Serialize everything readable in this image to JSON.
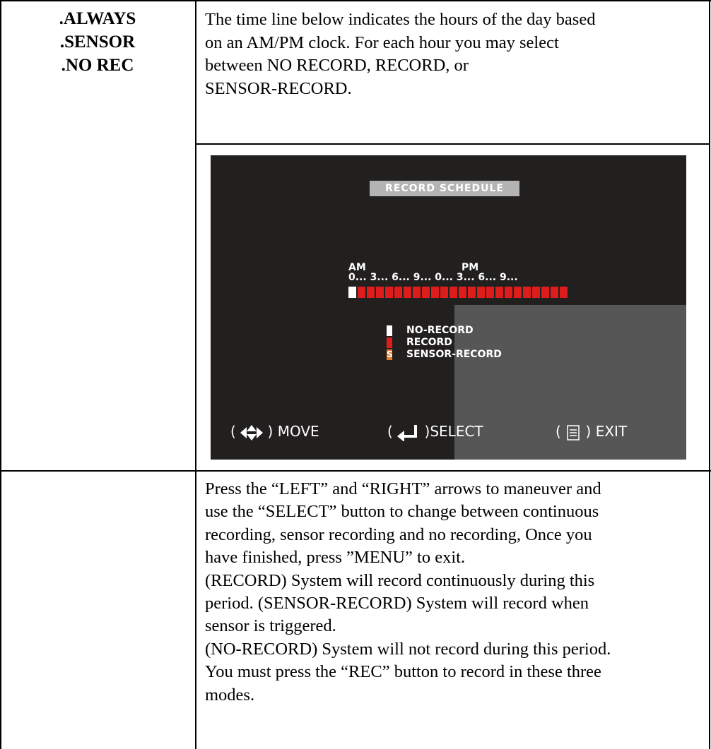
{
  "modes": [
    ".ALWAYS",
    ".SENSOR",
    ".NO REC"
  ],
  "intro_lines": [
    "The time line below indicates the hours of the day based",
    "on an AM/PM clock. For each hour you may select",
    "between NO RECORD, RECORD, or",
    "SENSOR-RECORD."
  ],
  "osd": {
    "title": "RECORD SCHEDULE",
    "am_label": "AM",
    "pm_label": "PM",
    "hour_ticks": "0... 3... 6... 9... 0... 3... 6... 9...",
    "schedule": [
      "N",
      "R",
      "R",
      "R",
      "R",
      "R",
      "R",
      "R",
      "R",
      "R",
      "R",
      "R",
      "R",
      "R",
      "R",
      "R",
      "R",
      "R",
      "R",
      "R",
      "R",
      "R",
      "R",
      "R"
    ],
    "legend": [
      {
        "label": "NO-RECORD",
        "swatch": "white",
        "mark": ""
      },
      {
        "label": "RECORD",
        "swatch": "red",
        "mark": ""
      },
      {
        "label": "SENSOR-RECORD",
        "swatch": "orange",
        "mark": "S"
      }
    ],
    "nav": {
      "move_label": "MOVE",
      "select_label": "SELECT",
      "exit_label": "EXIT",
      "move_icon": "four-way-arrow-icon",
      "select_icon": "enter-arrow-icon",
      "exit_icon": "menu-icon"
    },
    "colors": {
      "background": "#221f1f",
      "record": "#dd1c1c",
      "sensor": "#e87b2a",
      "no_record": "#ffffff",
      "overlay": "#565656"
    }
  },
  "desc_lines": [
    "Press the “LEFT” and “RIGHT” arrows to maneuver and",
    "use the “SELECT” button to change between continuous",
    "recording, sensor recording and no recording, Once you",
    "have finished, press ”MENU” to exit.",
    "(RECORD) System will record continuously during this",
    "period. (SENSOR-RECORD) System will record when",
    "sensor is triggered.",
    "(NO-RECORD) System will not record during this period.",
    "You must press the “REC” button to record in these three",
    "modes."
  ]
}
